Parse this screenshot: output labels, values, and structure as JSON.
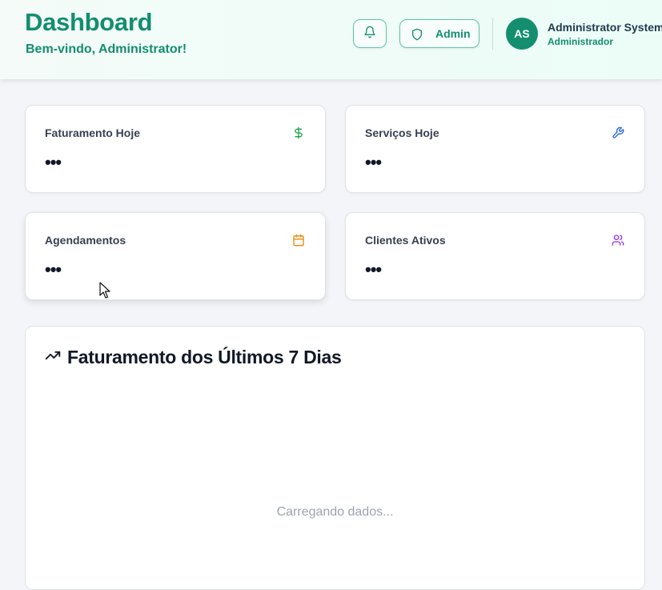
{
  "header": {
    "title": "Dashboard",
    "subtitle": "Bem-vindo, Administrator!",
    "admin_label": "Admin",
    "user": {
      "initials": "AS",
      "name": "Administrator System",
      "role": "Administrador"
    }
  },
  "stats": [
    {
      "title": "Faturamento Hoje",
      "value": "•••",
      "icon": "dollar-icon",
      "color": "#16a34a"
    },
    {
      "title": "Serviços Hoje",
      "value": "•••",
      "icon": "wrench-icon",
      "color": "#2563eb"
    },
    {
      "title": "Agendamentos",
      "value": "•••",
      "icon": "calendar-icon",
      "color": "#ea8a0c"
    },
    {
      "title": "Clientes Ativos",
      "value": "•••",
      "icon": "users-icon",
      "color": "#9333ea"
    }
  ],
  "chart": {
    "title": "Faturamento dos Últimos 7 Dias",
    "loading_text": "Carregando dados..."
  },
  "colors": {
    "brand": "#138e6f",
    "border_accent": "#5cc7a8"
  }
}
